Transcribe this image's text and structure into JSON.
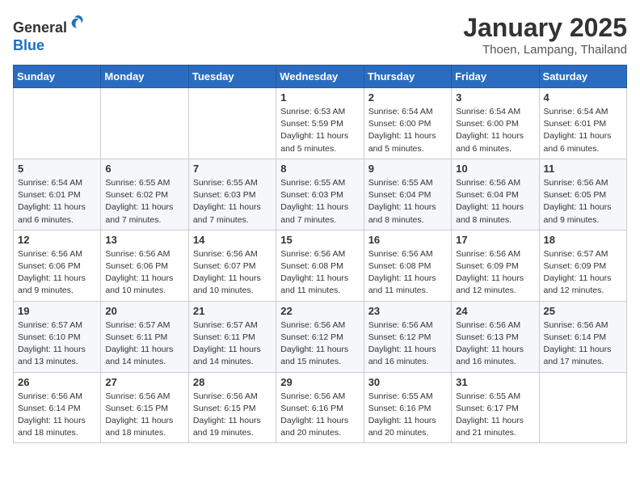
{
  "header": {
    "logo_line1": "General",
    "logo_line2": "Blue",
    "month_title": "January 2025",
    "location": "Thoen, Lampang, Thailand"
  },
  "weekdays": [
    "Sunday",
    "Monday",
    "Tuesday",
    "Wednesday",
    "Thursday",
    "Friday",
    "Saturday"
  ],
  "weeks": [
    [
      {
        "day": "",
        "info": ""
      },
      {
        "day": "",
        "info": ""
      },
      {
        "day": "",
        "info": ""
      },
      {
        "day": "1",
        "info": "Sunrise: 6:53 AM\nSunset: 5:59 PM\nDaylight: 11 hours\nand 5 minutes."
      },
      {
        "day": "2",
        "info": "Sunrise: 6:54 AM\nSunset: 6:00 PM\nDaylight: 11 hours\nand 5 minutes."
      },
      {
        "day": "3",
        "info": "Sunrise: 6:54 AM\nSunset: 6:00 PM\nDaylight: 11 hours\nand 6 minutes."
      },
      {
        "day": "4",
        "info": "Sunrise: 6:54 AM\nSunset: 6:01 PM\nDaylight: 11 hours\nand 6 minutes."
      }
    ],
    [
      {
        "day": "5",
        "info": "Sunrise: 6:54 AM\nSunset: 6:01 PM\nDaylight: 11 hours\nand 6 minutes."
      },
      {
        "day": "6",
        "info": "Sunrise: 6:55 AM\nSunset: 6:02 PM\nDaylight: 11 hours\nand 7 minutes."
      },
      {
        "day": "7",
        "info": "Sunrise: 6:55 AM\nSunset: 6:03 PM\nDaylight: 11 hours\nand 7 minutes."
      },
      {
        "day": "8",
        "info": "Sunrise: 6:55 AM\nSunset: 6:03 PM\nDaylight: 11 hours\nand 7 minutes."
      },
      {
        "day": "9",
        "info": "Sunrise: 6:55 AM\nSunset: 6:04 PM\nDaylight: 11 hours\nand 8 minutes."
      },
      {
        "day": "10",
        "info": "Sunrise: 6:56 AM\nSunset: 6:04 PM\nDaylight: 11 hours\nand 8 minutes."
      },
      {
        "day": "11",
        "info": "Sunrise: 6:56 AM\nSunset: 6:05 PM\nDaylight: 11 hours\nand 9 minutes."
      }
    ],
    [
      {
        "day": "12",
        "info": "Sunrise: 6:56 AM\nSunset: 6:06 PM\nDaylight: 11 hours\nand 9 minutes."
      },
      {
        "day": "13",
        "info": "Sunrise: 6:56 AM\nSunset: 6:06 PM\nDaylight: 11 hours\nand 10 minutes."
      },
      {
        "day": "14",
        "info": "Sunrise: 6:56 AM\nSunset: 6:07 PM\nDaylight: 11 hours\nand 10 minutes."
      },
      {
        "day": "15",
        "info": "Sunrise: 6:56 AM\nSunset: 6:08 PM\nDaylight: 11 hours\nand 11 minutes."
      },
      {
        "day": "16",
        "info": "Sunrise: 6:56 AM\nSunset: 6:08 PM\nDaylight: 11 hours\nand 11 minutes."
      },
      {
        "day": "17",
        "info": "Sunrise: 6:56 AM\nSunset: 6:09 PM\nDaylight: 11 hours\nand 12 minutes."
      },
      {
        "day": "18",
        "info": "Sunrise: 6:57 AM\nSunset: 6:09 PM\nDaylight: 11 hours\nand 12 minutes."
      }
    ],
    [
      {
        "day": "19",
        "info": "Sunrise: 6:57 AM\nSunset: 6:10 PM\nDaylight: 11 hours\nand 13 minutes."
      },
      {
        "day": "20",
        "info": "Sunrise: 6:57 AM\nSunset: 6:11 PM\nDaylight: 11 hours\nand 14 minutes."
      },
      {
        "day": "21",
        "info": "Sunrise: 6:57 AM\nSunset: 6:11 PM\nDaylight: 11 hours\nand 14 minutes."
      },
      {
        "day": "22",
        "info": "Sunrise: 6:56 AM\nSunset: 6:12 PM\nDaylight: 11 hours\nand 15 minutes."
      },
      {
        "day": "23",
        "info": "Sunrise: 6:56 AM\nSunset: 6:12 PM\nDaylight: 11 hours\nand 16 minutes."
      },
      {
        "day": "24",
        "info": "Sunrise: 6:56 AM\nSunset: 6:13 PM\nDaylight: 11 hours\nand 16 minutes."
      },
      {
        "day": "25",
        "info": "Sunrise: 6:56 AM\nSunset: 6:14 PM\nDaylight: 11 hours\nand 17 minutes."
      }
    ],
    [
      {
        "day": "26",
        "info": "Sunrise: 6:56 AM\nSunset: 6:14 PM\nDaylight: 11 hours\nand 18 minutes."
      },
      {
        "day": "27",
        "info": "Sunrise: 6:56 AM\nSunset: 6:15 PM\nDaylight: 11 hours\nand 18 minutes."
      },
      {
        "day": "28",
        "info": "Sunrise: 6:56 AM\nSunset: 6:15 PM\nDaylight: 11 hours\nand 19 minutes."
      },
      {
        "day": "29",
        "info": "Sunrise: 6:56 AM\nSunset: 6:16 PM\nDaylight: 11 hours\nand 20 minutes."
      },
      {
        "day": "30",
        "info": "Sunrise: 6:55 AM\nSunset: 6:16 PM\nDaylight: 11 hours\nand 20 minutes."
      },
      {
        "day": "31",
        "info": "Sunrise: 6:55 AM\nSunset: 6:17 PM\nDaylight: 11 hours\nand 21 minutes."
      },
      {
        "day": "",
        "info": ""
      }
    ]
  ]
}
